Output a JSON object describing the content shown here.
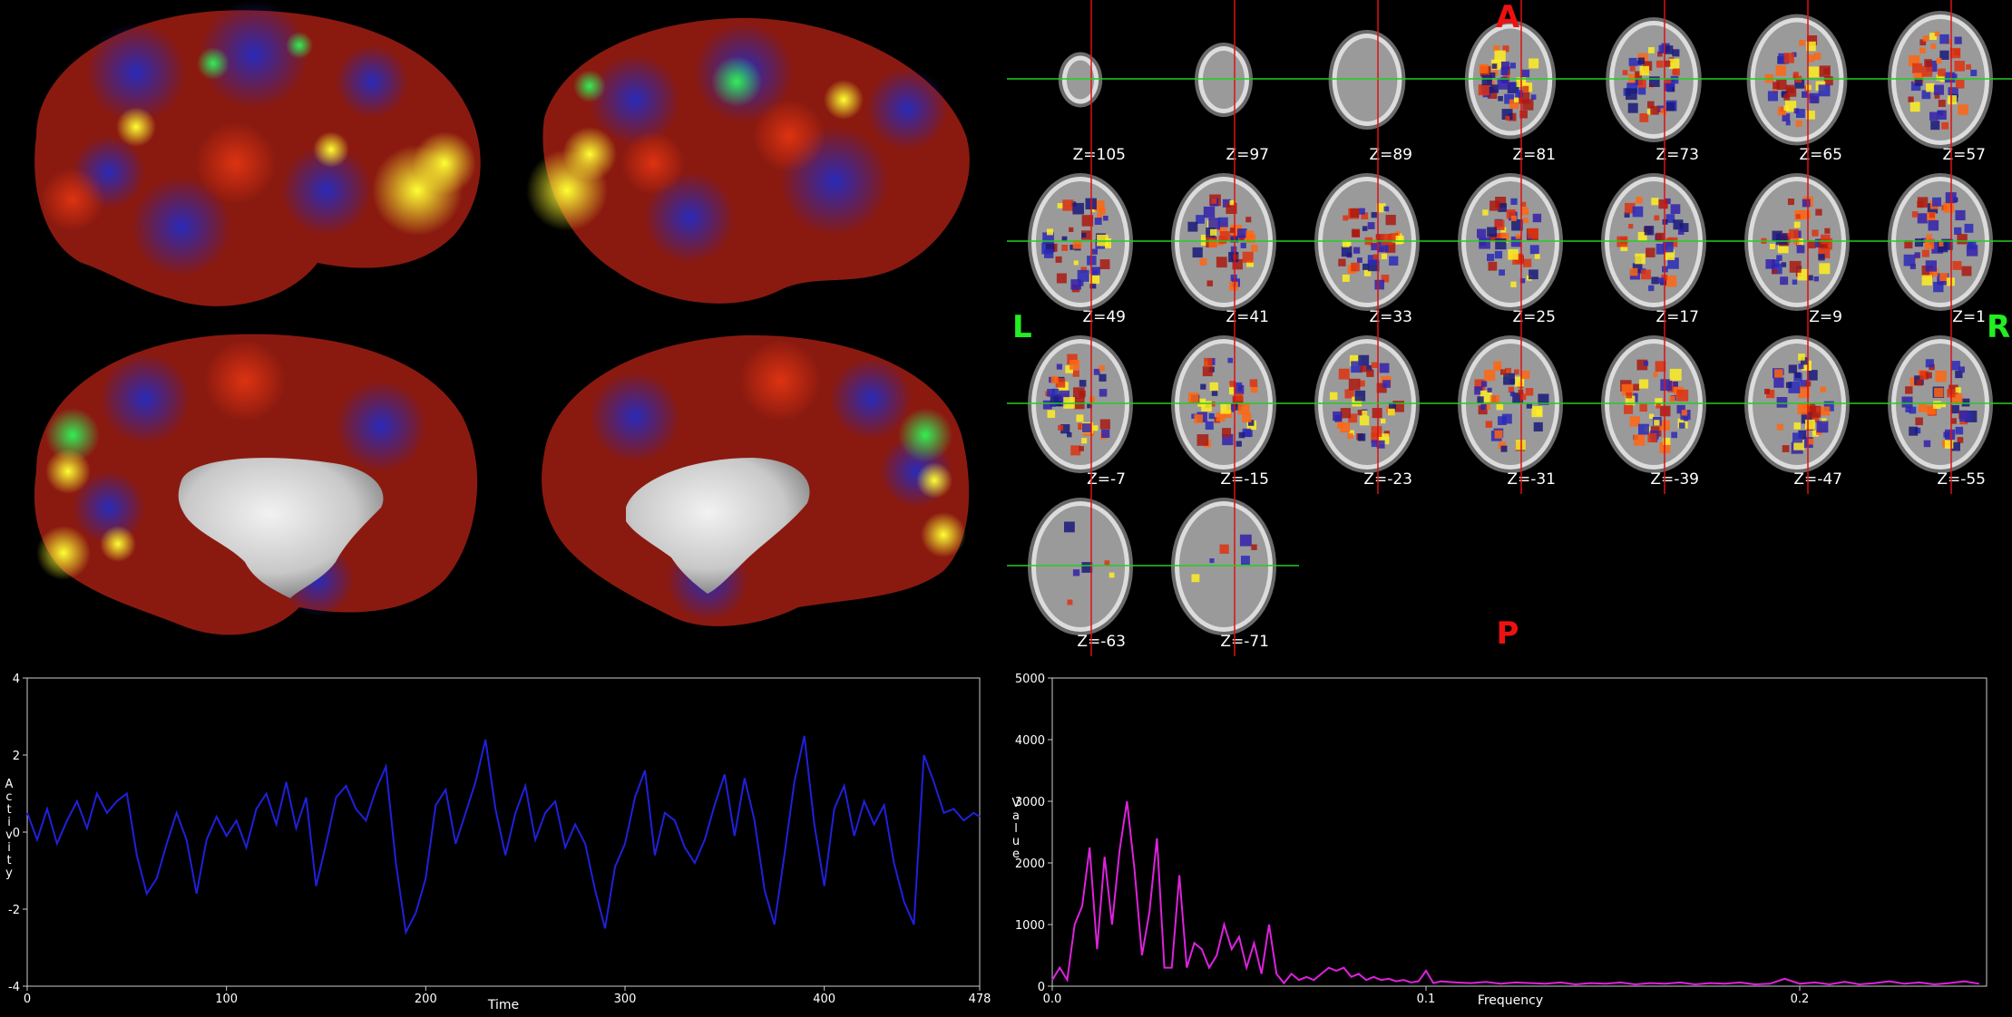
{
  "slices": {
    "orient_top": "A",
    "orient_bottom": "P",
    "orient_left": "L",
    "orient_right": "R",
    "rows": [
      [
        "Z=105",
        "Z=97",
        "Z=89",
        "Z=81",
        "Z=73",
        "Z=65",
        "Z=57"
      ],
      [
        "Z=49",
        "Z=41",
        "Z=33",
        "Z=25",
        "Z=17",
        "Z=9",
        "Z=1"
      ],
      [
        "Z=-7",
        "Z=-15",
        "Z=-23",
        "Z=-31",
        "Z=-39",
        "Z=-47",
        "Z=-55"
      ],
      [
        "Z=-63",
        "Z=-71"
      ]
    ]
  },
  "colors": {
    "background": "#000000",
    "crosshair_vertical": "#dd1111",
    "crosshair_horizontal": "#22cc22",
    "orient_ap": "#ee1111",
    "orient_lr": "#22ee22",
    "timeseries_line": "#2020dd",
    "power_line": "#dd22dd",
    "axis": "#cccccc"
  },
  "chart_data": [
    {
      "type": "line",
      "name": "timeseries",
      "xlabel": "Time",
      "ylabel": "Activity",
      "xlim": [
        0,
        478
      ],
      "ylim": [
        -4,
        4
      ],
      "xticks": [
        0,
        100,
        200,
        300,
        400,
        478
      ],
      "yticks": [
        4,
        2,
        0,
        -2,
        -4
      ],
      "x": [
        0,
        5,
        10,
        15,
        20,
        25,
        30,
        35,
        40,
        45,
        50,
        55,
        60,
        65,
        70,
        75,
        80,
        85,
        90,
        95,
        100,
        105,
        110,
        115,
        120,
        125,
        130,
        135,
        140,
        145,
        150,
        155,
        160,
        165,
        170,
        175,
        180,
        185,
        190,
        195,
        200,
        205,
        210,
        215,
        220,
        225,
        230,
        235,
        240,
        245,
        250,
        255,
        260,
        265,
        270,
        275,
        280,
        285,
        290,
        295,
        300,
        305,
        310,
        315,
        320,
        325,
        330,
        335,
        340,
        345,
        350,
        355,
        360,
        365,
        370,
        375,
        380,
        385,
        390,
        395,
        400,
        405,
        410,
        415,
        420,
        425,
        430,
        435,
        440,
        445,
        450,
        455,
        460,
        465,
        470,
        475,
        478
      ],
      "values": [
        0.5,
        -0.2,
        0.6,
        -0.3,
        0.3,
        0.8,
        0.1,
        1.0,
        0.5,
        0.8,
        1.0,
        -0.6,
        -1.6,
        -1.2,
        -0.3,
        0.5,
        -0.2,
        -1.6,
        -0.2,
        0.4,
        -0.1,
        0.3,
        -0.4,
        0.6,
        1.0,
        0.2,
        1.3,
        0.1,
        0.9,
        -1.4,
        -0.3,
        0.9,
        1.2,
        0.6,
        0.3,
        1.1,
        1.7,
        -0.8,
        -2.6,
        -2.1,
        -1.2,
        0.7,
        1.1,
        -0.3,
        0.5,
        1.3,
        2.4,
        0.6,
        -0.6,
        0.5,
        1.2,
        -0.2,
        0.5,
        0.8,
        -0.4,
        0.2,
        -0.3,
        -1.5,
        -2.5,
        -0.9,
        -0.3,
        0.9,
        1.6,
        -0.6,
        0.5,
        0.3,
        -0.4,
        -0.8,
        -0.2,
        0.7,
        1.5,
        -0.1,
        1.4,
        0.3,
        -1.5,
        -2.4,
        -0.6,
        1.3,
        2.5,
        0.2,
        -1.4,
        0.6,
        1.2,
        -0.1,
        0.8,
        0.2,
        0.7,
        -0.8,
        -1.8,
        -2.4,
        2.0,
        1.3,
        0.5,
        0.6,
        0.3,
        0.5,
        0.4
      ]
    },
    {
      "type": "line",
      "name": "power_spectrum",
      "xlabel": "Frequency",
      "ylabel": "Value",
      "xlim": [
        0,
        0.25
      ],
      "ylim": [
        0,
        5000
      ],
      "xticks": [
        0.0,
        0.1,
        0.2
      ],
      "yticks": [
        5000,
        4000,
        3000,
        2000,
        1000,
        0
      ],
      "x": [
        0.0,
        0.002,
        0.004,
        0.006,
        0.008,
        0.01,
        0.012,
        0.014,
        0.016,
        0.018,
        0.02,
        0.022,
        0.024,
        0.026,
        0.028,
        0.03,
        0.032,
        0.034,
        0.036,
        0.038,
        0.04,
        0.042,
        0.044,
        0.046,
        0.048,
        0.05,
        0.052,
        0.054,
        0.056,
        0.058,
        0.06,
        0.062,
        0.064,
        0.066,
        0.068,
        0.07,
        0.072,
        0.074,
        0.076,
        0.078,
        0.08,
        0.082,
        0.084,
        0.086,
        0.088,
        0.09,
        0.092,
        0.094,
        0.096,
        0.098,
        0.1,
        0.102,
        0.104,
        0.108,
        0.112,
        0.116,
        0.12,
        0.124,
        0.128,
        0.132,
        0.136,
        0.14,
        0.144,
        0.148,
        0.152,
        0.156,
        0.16,
        0.164,
        0.168,
        0.172,
        0.176,
        0.18,
        0.184,
        0.188,
        0.192,
        0.196,
        0.2,
        0.204,
        0.208,
        0.212,
        0.216,
        0.22,
        0.224,
        0.228,
        0.232,
        0.236,
        0.24,
        0.244,
        0.248
      ],
      "values": [
        100,
        300,
        100,
        1000,
        1300,
        2250,
        600,
        2100,
        1000,
        2200,
        3000,
        1900,
        500,
        1200,
        2400,
        300,
        300,
        1800,
        300,
        700,
        600,
        300,
        500,
        1000,
        600,
        800,
        300,
        700,
        200,
        1000,
        200,
        50,
        200,
        100,
        150,
        100,
        200,
        300,
        250,
        300,
        150,
        200,
        100,
        150,
        100,
        120,
        80,
        100,
        60,
        80,
        250,
        50,
        80,
        60,
        50,
        70,
        40,
        60,
        50,
        40,
        60,
        30,
        50,
        40,
        60,
        30,
        50,
        40,
        60,
        30,
        50,
        40,
        60,
        30,
        40,
        120,
        40,
        60,
        30,
        70,
        30,
        50,
        80,
        40,
        60,
        30,
        50,
        80,
        40
      ]
    }
  ]
}
